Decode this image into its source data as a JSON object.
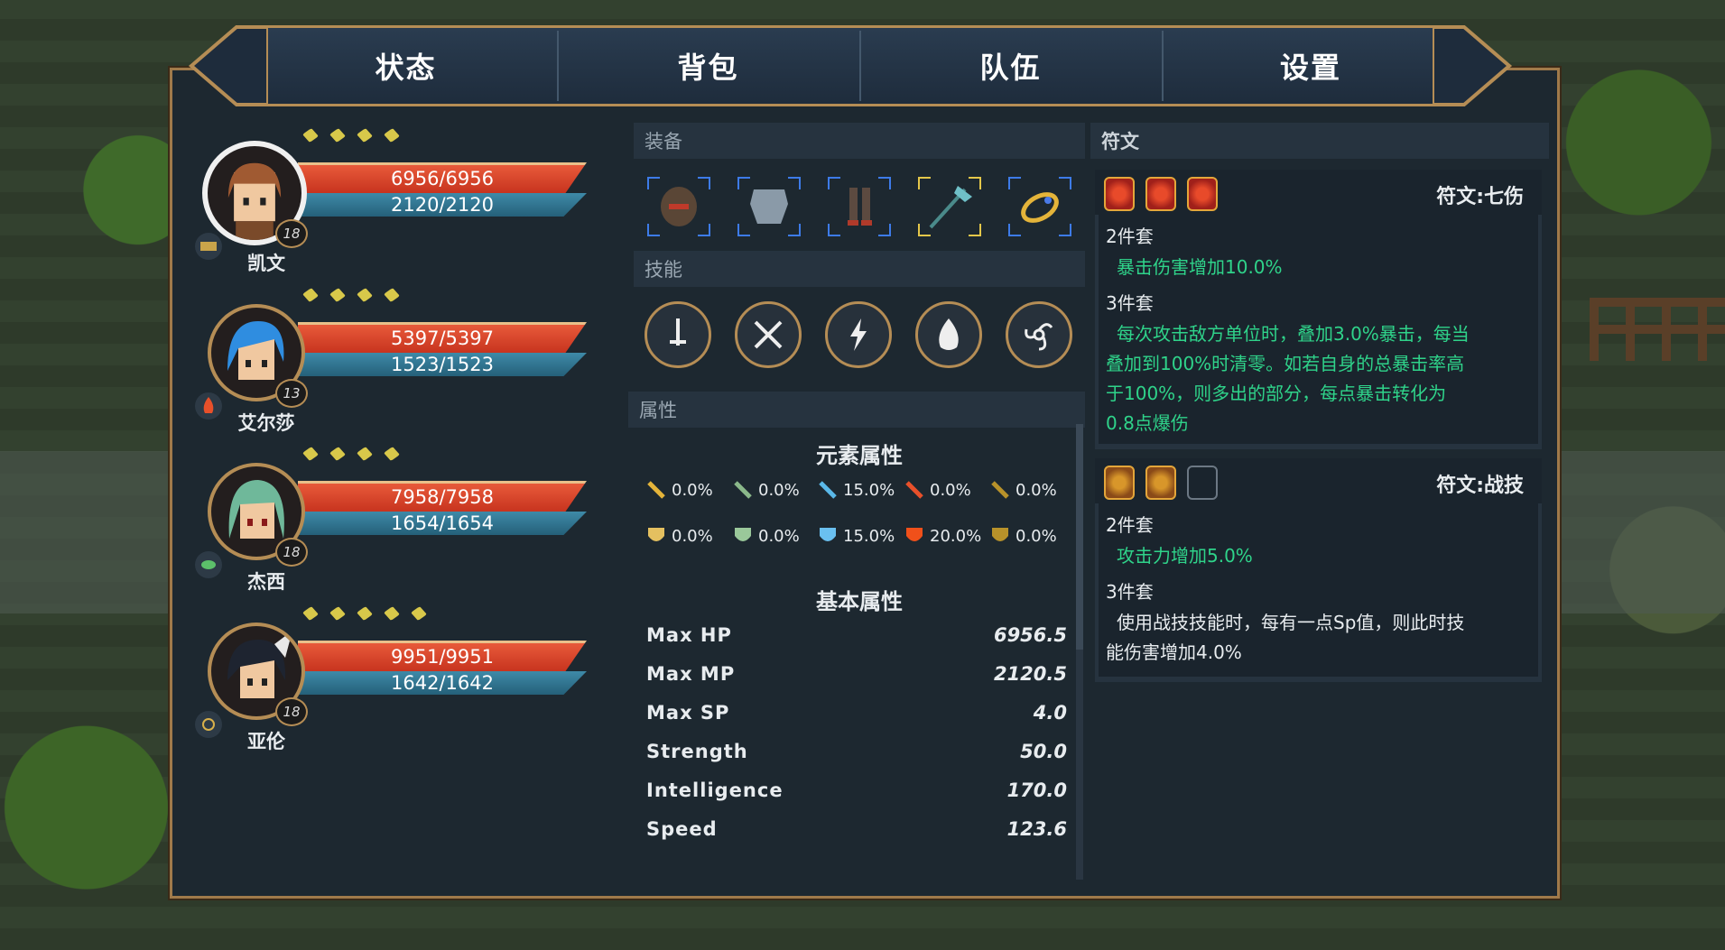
{
  "tabs": [
    "状态",
    "背包",
    "队伍",
    "设置"
  ],
  "characters": [
    {
      "name": "凯文",
      "level": "18",
      "hp": "6956/6956",
      "mp": "2120/2120",
      "pips": 4,
      "element": "scroll-icon",
      "selected": true
    },
    {
      "name": "艾尔莎",
      "level": "13",
      "hp": "5397/5397",
      "mp": "1523/1523",
      "pips": 4,
      "element": "fire-icon",
      "selected": false
    },
    {
      "name": "杰西",
      "level": "18",
      "hp": "7958/7958",
      "mp": "1654/1654",
      "pips": 4,
      "element": "leaf-icon",
      "selected": false
    },
    {
      "name": "亚伦",
      "level": "18",
      "hp": "9951/9951",
      "mp": "1642/1642",
      "pips": 5,
      "element": "wind-icon",
      "selected": false
    }
  ],
  "equipment": {
    "header": "装备",
    "slots": [
      {
        "item": "helmet-icon",
        "rarity": "blue"
      },
      {
        "item": "chest-armor-icon",
        "rarity": "blue"
      },
      {
        "item": "leg-armor-icon",
        "rarity": "blue"
      },
      {
        "item": "axe-icon",
        "rarity": "gold"
      },
      {
        "item": "ring-icon",
        "rarity": "blue"
      }
    ]
  },
  "skills": {
    "header": "技能",
    "items": [
      "sword-icon",
      "crossed-swords-icon",
      "lightning-icon",
      "fire-icon",
      "triskelion-icon"
    ]
  },
  "attributes": {
    "header": "属性",
    "element_title": "元素属性",
    "attack_res": [
      {
        "icon": "sword-gold-icon",
        "value": "0.0%"
      },
      {
        "icon": "sword-green-icon",
        "value": "0.0%"
      },
      {
        "icon": "sword-blue-icon",
        "value": "15.0%"
      },
      {
        "icon": "sword-red-icon",
        "value": "0.0%"
      },
      {
        "icon": "sword-bronze-icon",
        "value": "0.0%"
      }
    ],
    "defense_res": [
      {
        "icon": "shield-gold-icon",
        "value": "0.0%"
      },
      {
        "icon": "shield-green-icon",
        "value": "0.0%"
      },
      {
        "icon": "shield-blue-icon",
        "value": "15.0%"
      },
      {
        "icon": "shield-red-icon",
        "value": "20.0%"
      },
      {
        "icon": "shield-bronze-icon",
        "value": "0.0%"
      }
    ],
    "basic_title": "基本属性",
    "stats": [
      {
        "name": "Max HP",
        "value": "6956.5"
      },
      {
        "name": "Max MP",
        "value": "2120.5"
      },
      {
        "name": "Max SP",
        "value": "4.0"
      },
      {
        "name": "Strength",
        "value": "50.0"
      },
      {
        "name": "Intelligence",
        "value": "170.0"
      },
      {
        "name": "Speed",
        "value": "123.6"
      }
    ]
  },
  "runes": {
    "header": "符文",
    "sets": [
      {
        "title": "符文:七伤",
        "icons": [
          "on",
          "on",
          "on"
        ],
        "two_label": "2件套",
        "two_text": "暴击伤害增加10.0%",
        "three_label": "3件套",
        "three_lines": [
          "每次攻击敌方单位时，叠加3.0%暴击，每当",
          "叠加到100%时清零。如若自身的总暴击率高",
          "于100%，则多出的部分，每点暴击转化为",
          "0.8点爆伤"
        ]
      },
      {
        "title": "符文:战技",
        "icons": [
          "on2",
          "on2",
          "off"
        ],
        "two_label": "2件套",
        "two_text": "攻击力增加5.0%",
        "three_label": "3件套",
        "three_lines": [
          "使用战技技能时，每有一点Sp值，则此时技",
          "能伤害增加4.0%"
        ]
      }
    ]
  },
  "colors": {
    "hp": "#d8432a",
    "mp": "#2f7390",
    "rune_active_text": "#2fd38a",
    "frame_gold": "#b58d55"
  }
}
